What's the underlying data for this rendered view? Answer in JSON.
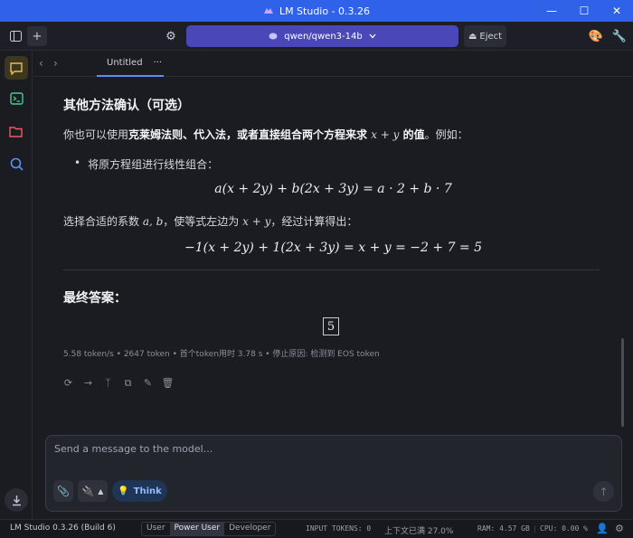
{
  "window": {
    "title": "LM Studio - 0.3.26",
    "controls": [
      "minimize",
      "maximize",
      "close"
    ]
  },
  "toolbar": {
    "model": "qwen/qwen3-14b",
    "eject_label": "Eject"
  },
  "tabs": [
    {
      "label": "Untitled",
      "menu": "···"
    }
  ],
  "message": {
    "alt_heading": "其他方法确认（可选）",
    "p1_prefix": "你也可以使用",
    "p1_bold": "克莱姆法则、代入法，或者直接组合两个方程来求 ",
    "p1_math": "x + y",
    "p1_bold_end": " 的值",
    "p1_suffix": "。例如：",
    "bullet": "将原方程组进行线性组合：",
    "eq1": "a(x + 2y) + b(2x + 3y) = a · 2 + b · 7",
    "p2_prefix": "选择合适的系数 ",
    "p2_math1": "a, b",
    "p2_mid": "，使等式左边为 ",
    "p2_math2": "x + y",
    "p2_suffix": "，经过计算得出：",
    "eq2": "−1(x + 2y) + 1(2x + 3y) = x + y = −2 + 7 = 5",
    "final_heading": "最终答案：",
    "answer": "5",
    "stats": "5.58 token/s • 2647 token • 首个token用时 3.78 s • 停止原因: 检测到 EOS token"
  },
  "composer": {
    "placeholder": "Send a message to the model...",
    "think_label": "Think"
  },
  "statusbar": {
    "app": "LM Studio 0.3.26 (Build 6)",
    "modes": [
      "User",
      "Power User",
      "Developer"
    ],
    "active_mode": "Power User",
    "input_tokens": "INPUT TOKENS:  0",
    "context": "上下文已满 27.0%",
    "ram": "RAM: 4.57 GB",
    "cpu": "CPU: 0.00 %"
  },
  "colors": {
    "titlebar": "#2f62e8",
    "model_selector": "#4a48b8",
    "background": "#1b1c22",
    "think_accent": "#8ebbff"
  }
}
